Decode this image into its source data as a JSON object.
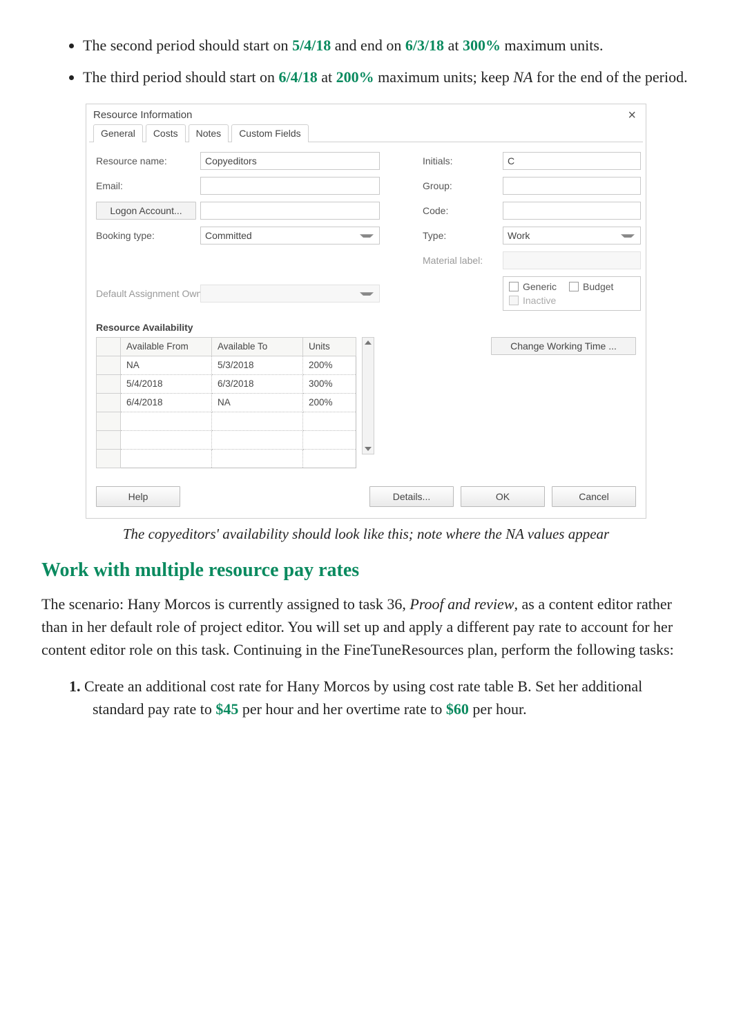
{
  "bullets": {
    "b2": {
      "pre": "The second period should start on ",
      "d1": "5/4/18",
      "mid1": " and end on ",
      "d2": "6/3/18",
      "mid2": " at ",
      "pct": "300%",
      "post": " maximum units."
    },
    "b3": {
      "pre": "The third period should start on ",
      "d1": "6/4/18",
      "mid1": " at ",
      "pct": "200%",
      "post": " maximum units; keep ",
      "na": "NA",
      "end": " for the end of the period."
    }
  },
  "dialog": {
    "title": "Resource Information",
    "tabs": [
      "General",
      "Costs",
      "Notes",
      "Custom Fields"
    ],
    "labels": {
      "resource_name": "Resource name:",
      "email": "Email:",
      "logon": "Logon Account...",
      "booking_type": "Booking type:",
      "default_owner": "Default Assignment Owner:",
      "availability": "Resource Availability",
      "initials": "Initials:",
      "group": "Group:",
      "code": "Code:",
      "type": "Type:",
      "material": "Material label:"
    },
    "values": {
      "resource_name": "Copyeditors",
      "booking_type": "Committed",
      "initials": "C",
      "type": "Work"
    },
    "checks": {
      "generic": "Generic",
      "budget": "Budget",
      "inactive": "Inactive"
    },
    "change_working_time": "Change Working Time ...",
    "table": {
      "headers": {
        "from": "Available From",
        "to": "Available To",
        "units": "Units"
      },
      "rows": [
        {
          "from": "NA",
          "to": "5/3/2018",
          "units": "200%"
        },
        {
          "from": "5/4/2018",
          "to": "6/3/2018",
          "units": "300%"
        },
        {
          "from": "6/4/2018",
          "to": "NA",
          "units": "200%"
        }
      ]
    },
    "buttons": {
      "help": "Help",
      "details": "Details...",
      "ok": "OK",
      "cancel": "Cancel"
    }
  },
  "caption": "The copyeditors' availability should look like this; note where the NA values appear",
  "section": {
    "heading": "Work with multiple resource pay rates",
    "para": {
      "p1": "The scenario: Hany Morcos is currently assigned to task 36, ",
      "taskname": "Proof and review",
      "p2": ", as a content editor rather than in her default role of project editor. You will set up and apply a different pay rate to account for her content editor role on this task. Continuing in the FineTuneResources plan, perform the following tasks:"
    },
    "step1": {
      "num": "1.",
      "t1": " Create an additional cost rate for Hany Morcos by using cost rate table B. Set her additional standard pay rate to ",
      "v1": "$45",
      "t2": " per hour and her overtime rate to ",
      "v2": "$60",
      "t3": " per hour."
    }
  }
}
